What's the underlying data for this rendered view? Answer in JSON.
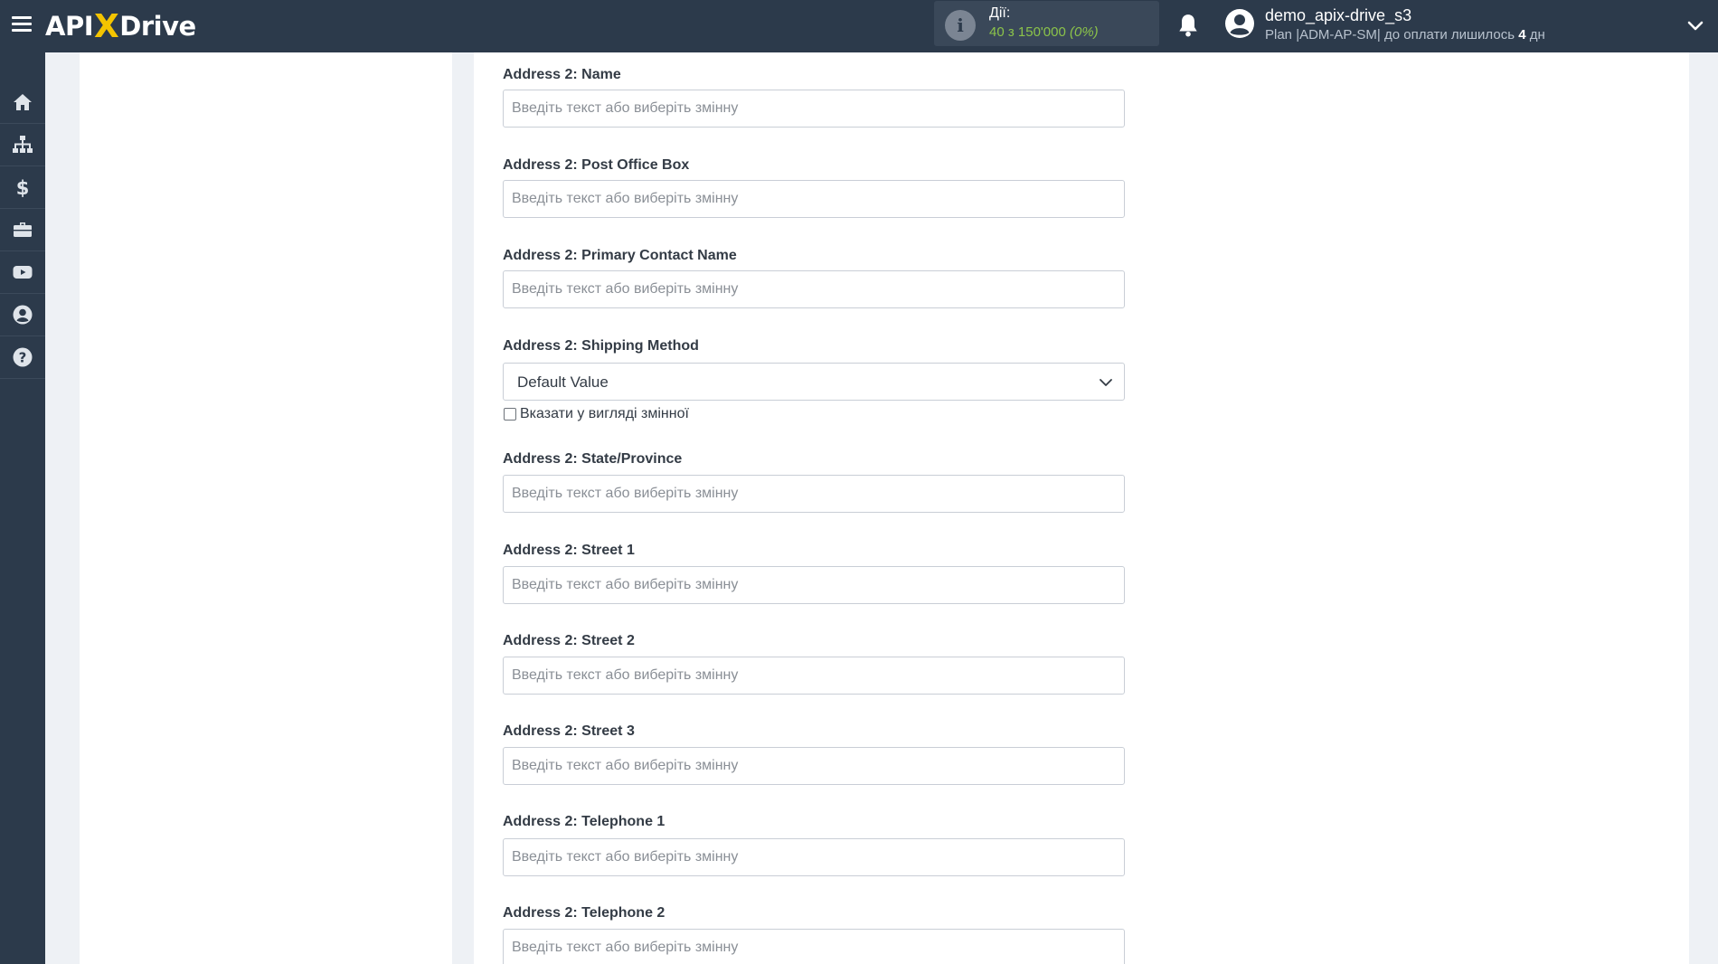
{
  "header": {
    "logo": {
      "api": "API",
      "x": "X",
      "drive": "Drive"
    },
    "actions": {
      "title": "Дії:",
      "count": "40 з 150'000",
      "percent": "(0%)"
    },
    "user": {
      "name": "demo_apix-drive_s3",
      "plan_prefix": "Plan |ADM-AP-SM| до оплати лишилось ",
      "days_left": "4",
      "days_unit": " дн"
    }
  },
  "sidebar": {
    "items": [
      {
        "name": "home-icon"
      },
      {
        "name": "sitemap-icon"
      },
      {
        "name": "dollar-icon"
      },
      {
        "name": "briefcase-icon"
      },
      {
        "name": "youtube-icon"
      },
      {
        "name": "user-circle-icon"
      },
      {
        "name": "question-circle-icon"
      }
    ]
  },
  "form": {
    "placeholder": "Введіть текст або виберіть змінну",
    "fields": [
      {
        "label": "Address 2: Name"
      },
      {
        "label": "Address 2: Post Office Box"
      },
      {
        "label": "Address 2: Primary Contact Name"
      },
      {
        "label": "Address 2: Shipping Method",
        "type": "select",
        "value": "Default Value",
        "checkbox_label": "Вказати у вигляді змінної"
      },
      {
        "label": "Address 2: State/Province"
      },
      {
        "label": "Address 2: Street 1"
      },
      {
        "label": "Address 2: Street 2"
      },
      {
        "label": "Address 2: Street 3"
      },
      {
        "label": "Address 2: Telephone 1"
      },
      {
        "label": "Address 2: Telephone 2"
      }
    ]
  },
  "colors": {
    "topbar": "#2c3a4b",
    "logo_accent": "#f4c400",
    "actions_count": "#8bc34a",
    "background": "#eef1f5"
  }
}
